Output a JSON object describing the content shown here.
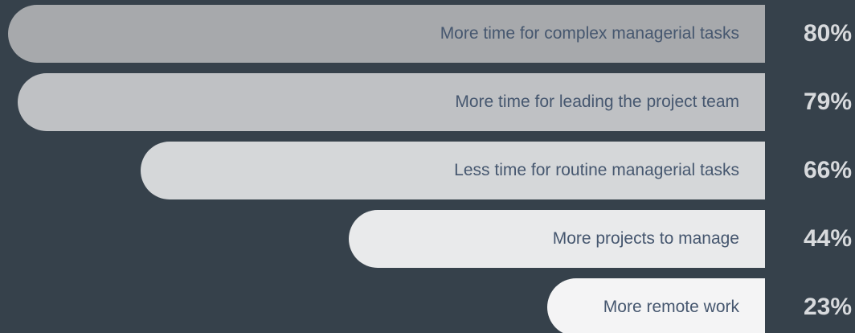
{
  "chart_data": {
    "type": "bar",
    "orientation": "horizontal",
    "categories": [
      "More time for complex managerial tasks",
      "More time for leading the project team",
      "Less time for routine managerial tasks",
      "More projects to manage",
      "More remote work"
    ],
    "values": [
      80,
      79,
      66,
      44,
      23
    ],
    "value_labels": [
      "80%",
      "79%",
      "66%",
      "44%",
      "23%"
    ],
    "xlim": [
      0,
      80
    ],
    "grid": false,
    "bar_colors": [
      "#a7a9ac",
      "#bfc1c4",
      "#d5d7d9",
      "#e9eaeb",
      "#f4f4f5"
    ],
    "label_color": "#46576f",
    "value_color": "#d8dadd",
    "background": "#36414b"
  }
}
